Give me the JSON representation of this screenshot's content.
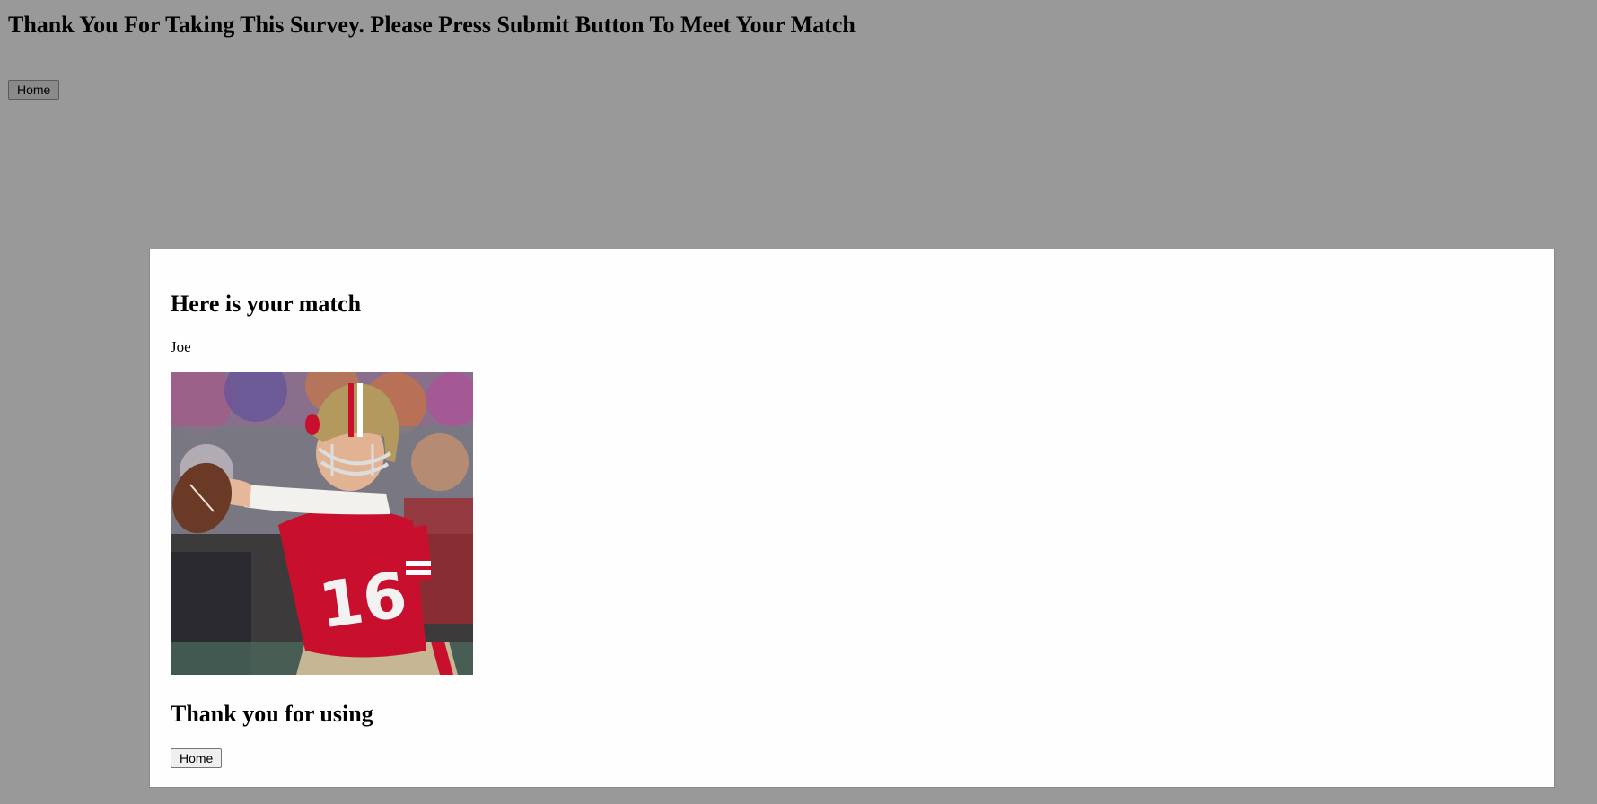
{
  "header": {
    "title": "Thank You For Taking This Survey. Please Press Submit Button To Meet Your Match",
    "home_label": "Home"
  },
  "modal": {
    "heading": "Here is your match",
    "match_name": "Joe",
    "photo_subject": "football player in red number 16 jersey throwing a football",
    "thanks_heading": "Thank you for using",
    "home_label": "Home"
  },
  "colors": {
    "page_background": "#999999",
    "modal_background": "#fefefe",
    "jersey_red": "#c8102e",
    "helmet_gold": "#b3995d"
  }
}
